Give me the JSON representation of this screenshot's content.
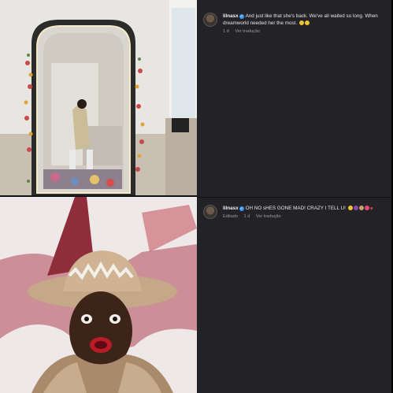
{
  "comments": [
    {
      "username": "lilnasx",
      "text": "And just like that she's back. We've all waited so long. When dreamworld needed her the most.",
      "emojis": [
        "smile-emoji",
        "smile-emoji"
      ],
      "time": "1 d",
      "translate": "Ver tradução"
    },
    {
      "username": "lilnasx",
      "text": "OH NO sHES GONE MAD! CRAZY I TELL U!",
      "emojis": [
        "laugh-emoji",
        "purple-devil-emoji",
        "hands-emoji",
        "pink-emoji",
        "heart-emoji"
      ],
      "edited": "Editado",
      "time": "1 d",
      "translate": "Ver tradução"
    }
  ],
  "colors": {
    "panel_bg": "#232327",
    "verified": "#3a9cf0",
    "meta_text": "#9b9b9b"
  }
}
